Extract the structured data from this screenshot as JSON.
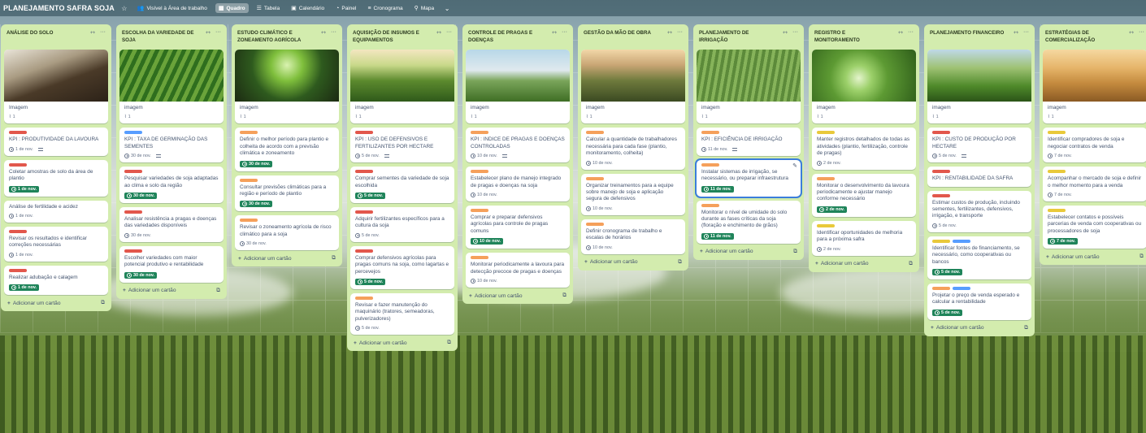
{
  "board": {
    "title": "PLANEJAMENTO SAFRA SOJA",
    "visibility": "Visível à Área de trabalho",
    "views": [
      "Quadro",
      "Tabela",
      "Calendário",
      "Painel",
      "Cronograma",
      "Mapa"
    ],
    "active_view": "Quadro"
  },
  "colors": {
    "list_bg": "#d3ecae",
    "label_red": "#e2574c",
    "label_orange": "#f5a05b",
    "label_yellow": "#e9c93a",
    "label_blue": "#579dff",
    "due_green": "#1f845a",
    "focus_blue": "#3b7ddb"
  },
  "add_card_label": "Adicionar um cartão",
  "lists": [
    {
      "title": "ANÁLISE DO SOLO",
      "cover": {
        "theme": "soil-hand",
        "label": "Imagem",
        "attachments": "1"
      },
      "cards": [
        {
          "labels": [
            "red"
          ],
          "title": "KPI : PRODUTIVIDADE DA LAVOURA",
          "date": "1 de nov.",
          "due": false,
          "desc": true
        },
        {
          "labels": [
            "red"
          ],
          "title": "Coletar amostras de solo da área de plantio",
          "date": "1 de nov.",
          "due": true
        },
        {
          "labels": [],
          "title": "Análise de fertilidade e acidez",
          "date": "1 de nov.",
          "due": false
        },
        {
          "labels": [
            "red"
          ],
          "title": "Revisar os resultados e identificar correções necessárias",
          "date": "1 de nov.",
          "due": false
        },
        {
          "labels": [
            "red"
          ],
          "title": "Realizar adubação e calagem",
          "date": "1 de nov.",
          "due": true
        }
      ]
    },
    {
      "title": "ESCOLHA DA VARIEDADE DE SOJA",
      "cover": {
        "theme": "soy-rows",
        "label": "imagem",
        "attachments": "1"
      },
      "cards": [
        {
          "labels": [
            "blue"
          ],
          "title": "KPI : TAXA DE GERMINAÇÃO DAS SEMENTES",
          "date": "30 de nov.",
          "due": false,
          "desc": true
        },
        {
          "labels": [
            "red"
          ],
          "title": "Pesquisar variedades de soja adaptadas ao clima e solo da região",
          "date": "30 de nov.",
          "due": true
        },
        {
          "labels": [
            "red"
          ],
          "title": "Analisar resistência a pragas e doenças das variedades disponíveis",
          "date": "30 de nov.",
          "due": false
        },
        {
          "labels": [
            "red"
          ],
          "title": "Escolher variedades com maior potencial produtivo e rentabilidade",
          "date": "30 de nov.",
          "due": true
        }
      ]
    },
    {
      "title": "ESTUDO CLIMÁTICO E ZONEAMENTO AGRÍCOLA",
      "cover": {
        "theme": "sprout",
        "label": "imagem",
        "attachments": "1"
      },
      "cards": [
        {
          "labels": [
            "orange"
          ],
          "title": "Definir o melhor período para plantio e colheita de acordo com a previsão climática e zoneamento",
          "date": "30 de nov.",
          "due": true
        },
        {
          "labels": [
            "orange"
          ],
          "title": "Consultar previsões climáticas para a região e período de plantio",
          "date": "30 de nov.",
          "due": true
        },
        {
          "labels": [
            "orange"
          ],
          "title": "Revisar o zoneamento agrícola de risco climático para a soja",
          "date": "30 de nov.",
          "due": false
        }
      ]
    },
    {
      "title": "AQUISIÇÃO DE INSUMOS E EQUIPAMENTOS",
      "cover": {
        "theme": "farmer-field",
        "label": "imagem",
        "attachments": "1"
      },
      "cards": [
        {
          "labels": [
            "red"
          ],
          "title": "KPI : USO DE DEFENSIVOS E FERTILIZANTES POR HECTARE",
          "date": "5 de nov.",
          "due": false,
          "desc": true
        },
        {
          "labels": [
            "red"
          ],
          "title": "Comprar sementes da variedade de soja escolhida",
          "date": "5 de nov.",
          "due": true
        },
        {
          "labels": [
            "red"
          ],
          "title": "Adquirir fertilizantes específicos para a cultura da soja",
          "date": "5 de nov.",
          "due": false
        },
        {
          "labels": [
            "red"
          ],
          "title": "Comprar defensivos agrícolas para pragas comuns na soja, como lagartas e percevejos",
          "date": "5 de nov.",
          "due": true
        },
        {
          "labels": [
            "orange"
          ],
          "title": "Revisar e fazer manutenção do maquinário (tratores, semeadoras, pulverizadores)",
          "date": "5 de nov.",
          "due": false
        }
      ]
    },
    {
      "title": "CONTROLE DE PRAGAS E DOENÇAS",
      "cover": {
        "theme": "hazmat",
        "label": "imagem",
        "attachments": "1"
      },
      "cards": [
        {
          "labels": [
            "orange"
          ],
          "title": "KPI : INDICE DE PRAGAS E DOENÇAS CONTROLADAS",
          "date": "10 de nov.",
          "due": false,
          "desc": true
        },
        {
          "labels": [
            "orange"
          ],
          "title": "Estabelecer plano de manejo integrado de pragas e doenças na soja",
          "date": "10 de nov.",
          "due": false
        },
        {
          "labels": [
            "orange"
          ],
          "title": "Comprar e preparar defensivos agrícolas para controle de pragas comuns",
          "date": "10 de nov.",
          "due": true
        },
        {
          "labels": [
            "orange"
          ],
          "title": "Monitorar periodicamente a lavoura para detecção precoce de pragas e doenças",
          "date": "10 de nov.",
          "due": false
        }
      ]
    },
    {
      "title": "GESTÃO DA MÃO DE OBRA",
      "cover": {
        "theme": "hand-sprout",
        "label": "imagem",
        "attachments": "1"
      },
      "cards": [
        {
          "labels": [
            "orange"
          ],
          "title": "Calcular a quantidade de trabalhadores necessária para cada fase (plantio, monitoramento, colheita)",
          "date": "10 de nov.",
          "due": false
        },
        {
          "labels": [
            "orange"
          ],
          "title": "Organizar treinamentos para a equipe sobre manejo de soja e aplicação segura de defensivos",
          "date": "10 de nov.",
          "due": false
        },
        {
          "labels": [
            "orange"
          ],
          "title": "Definir cronograma de trabalho e escalas de horários",
          "date": "10 de nov.",
          "due": false
        }
      ]
    },
    {
      "title": "PLANEJAMENTO DE IRRIGAÇÃO",
      "cover": {
        "theme": "sprinkler",
        "label": "imagem",
        "attachments": "1"
      },
      "cards": [
        {
          "labels": [
            "orange"
          ],
          "title": "KPI : EFICIÊNCIA DE IRRIGAÇÃO",
          "date": "11 de nov.",
          "due": false,
          "desc": true
        },
        {
          "labels": [
            "orange"
          ],
          "title": "Instalar sistemas de irrigação, se necessário, ou preparar infraestrutura",
          "date": "11 de nov.",
          "due": true,
          "focused": true
        },
        {
          "labels": [
            "orange"
          ],
          "title": "Monitorar o nível de umidade do solo durante as fases críticas da soja (floração e enchimento de grãos)",
          "date": "11 de nov.",
          "due": true
        }
      ]
    },
    {
      "title": "REGISTRO E MONITORAMENTO",
      "cover": {
        "theme": "magnifier",
        "label": "imagem",
        "attachments": "1"
      },
      "cards": [
        {
          "labels": [
            "yellow"
          ],
          "title": "Manter registros detalhados de todas as atividades (plantio, fertilização, controle de pragas)",
          "date": "2 de nov.",
          "due": false
        },
        {
          "labels": [
            "orange"
          ],
          "title": "Monitorar o desenvolvimento da lavoura periodicamente e ajustar manejo conforme necessário",
          "date": "2 de nov.",
          "due": true
        },
        {
          "labels": [
            "yellow"
          ],
          "title": "Identificar oportunidades de melhoria para a próxima safra",
          "date": "2 de nov.",
          "due": false
        }
      ]
    },
    {
      "title": "PLANEJAMENTO FINANCEIRO",
      "cover": {
        "theme": "farmer-laptop",
        "label": "imagem",
        "attachments": "1"
      },
      "cards": [
        {
          "labels": [
            "red"
          ],
          "title": "KPI : CUSTO DE PRODUÇÃO POR HECTARE",
          "date": "5 de nov.",
          "due": false,
          "desc": true
        },
        {
          "labels": [
            "red"
          ],
          "title": "KPI : RENTABILIDADE DA SAFRA",
          "date": "",
          "due": false
        },
        {
          "labels": [
            "red"
          ],
          "title": "Estimar custos de produção, incluindo sementes, fertilizantes, defensivos, irrigação, e transporte",
          "date": "5 de nov.",
          "due": false
        },
        {
          "labels": [
            "yellow",
            "blue"
          ],
          "title": "Identificar fontes de financiamento, se necessário, como cooperativas ou bancos",
          "date": "5 de nov.",
          "due": true
        },
        {
          "labels": [
            "orange",
            "blue"
          ],
          "title": "Projetar o preço de venda esperado e calcular a rentabilidade",
          "date": "5 de nov.",
          "due": true
        }
      ]
    },
    {
      "title": "ESTRATÉGIAS DE COMERCIALIZAÇÃO",
      "cover": {
        "theme": "handshake",
        "label": "imagem",
        "attachments": "1"
      },
      "cards": [
        {
          "labels": [
            "yellow"
          ],
          "title": "Identificar compradores de soja e negociar contratos de venda",
          "date": "7 de nov.",
          "due": false
        },
        {
          "labels": [
            "yellow"
          ],
          "title": "Acompanhar o mercado de soja e definir o melhor momento para a venda",
          "date": "7 de nov.",
          "due": false
        },
        {
          "labels": [
            "yellow"
          ],
          "title": "Estabelecer contatos e possíveis parcerias de venda com cooperativas ou processadores de soja",
          "date": "7 de nov.",
          "due": true
        }
      ]
    }
  ]
}
